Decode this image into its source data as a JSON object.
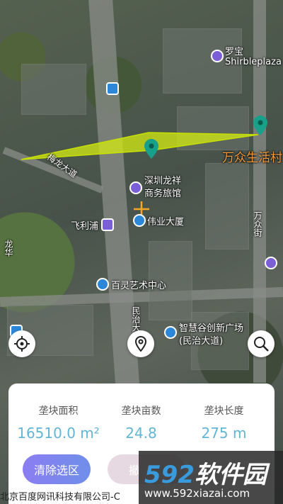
{
  "map": {
    "labels": {
      "luobao": "罗宝",
      "shirble": "Shirbleplaza",
      "wanzhong": "万众生活村",
      "shenzhen_longxiang": "深圳龙祥",
      "shangwu_lvguan": "商务旅馆",
      "feilipu": "飞利浦",
      "weiye": "伟业大厦",
      "bailing": "百灵艺术中心",
      "zhihuigu": "智慧谷创新广场",
      "minzhi": "(民治大道)",
      "road_left": "梅龙大道",
      "road_right": "万众街",
      "road_lower": "民治大道",
      "road_mid": "龙华"
    },
    "selection_color": "#d4ee10",
    "pin_color": "#18a08a"
  },
  "controls": {
    "locate_icon": "crosshair-icon",
    "pin_icon": "location-pin-icon",
    "search_icon": "search-icon"
  },
  "panel": {
    "area_title": "垄块面积",
    "area_value": "16510.0 m²",
    "mu_title": "垄块亩数",
    "mu_value": "24.8",
    "length_title": "垄块长度",
    "length_value": "275 m",
    "clear_button": "清除选区",
    "undo_button": "撤"
  },
  "copyright": "北京百度网讯科技有限公司-C",
  "watermark": {
    "logo_num": "592",
    "logo_text": "软件园",
    "url": "www.592xiazai.com"
  }
}
